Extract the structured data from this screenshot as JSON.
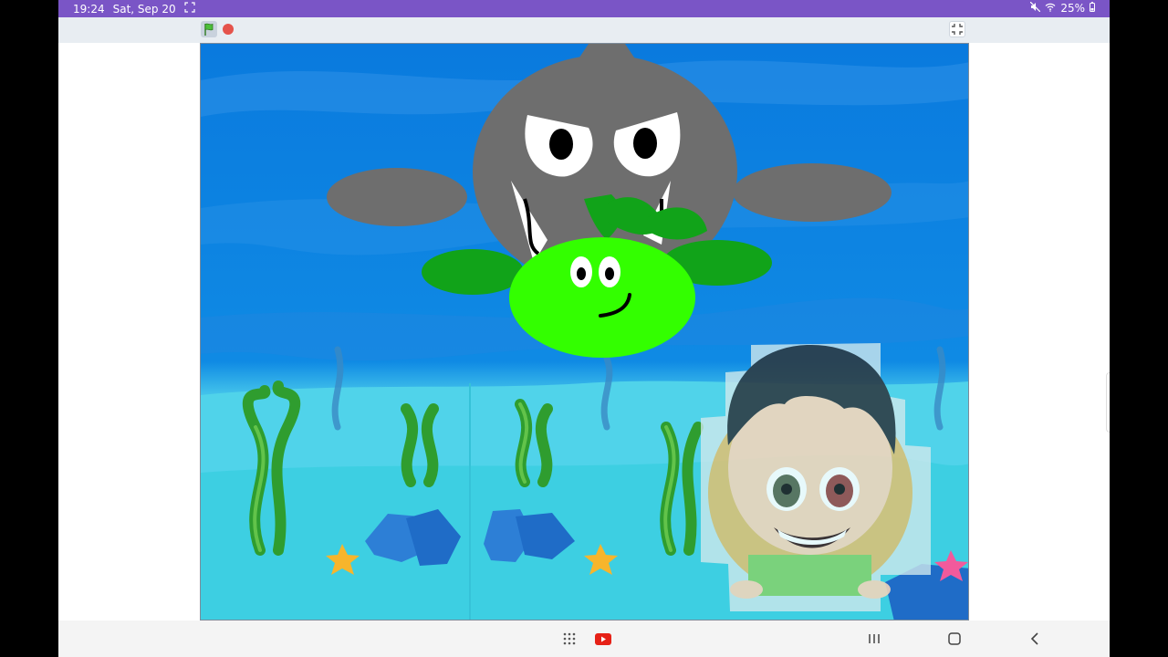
{
  "status_bar": {
    "time": "19:24",
    "date": "Sat, Sep 20",
    "battery": "25%"
  },
  "stage_header": {
    "flag_icon": "green-flag-icon",
    "stop_icon": "stop-icon",
    "fullscreen_icon": "exit-fullscreen-icon"
  },
  "stage": {
    "background": "underwater-scene",
    "sprites": [
      "shark",
      "green-sea-creature",
      "boy-avatar"
    ]
  },
  "nav_bar": {
    "icons": [
      "app-drawer-icon",
      "youtube-icon",
      "recents-icon",
      "home-icon",
      "back-icon"
    ]
  },
  "colors": {
    "status_bar": "#7a55c6",
    "water": "#0a79e0",
    "shark": "#6e6e6e",
    "creature": "#33ff00",
    "creature_leaves": "#11a319"
  }
}
